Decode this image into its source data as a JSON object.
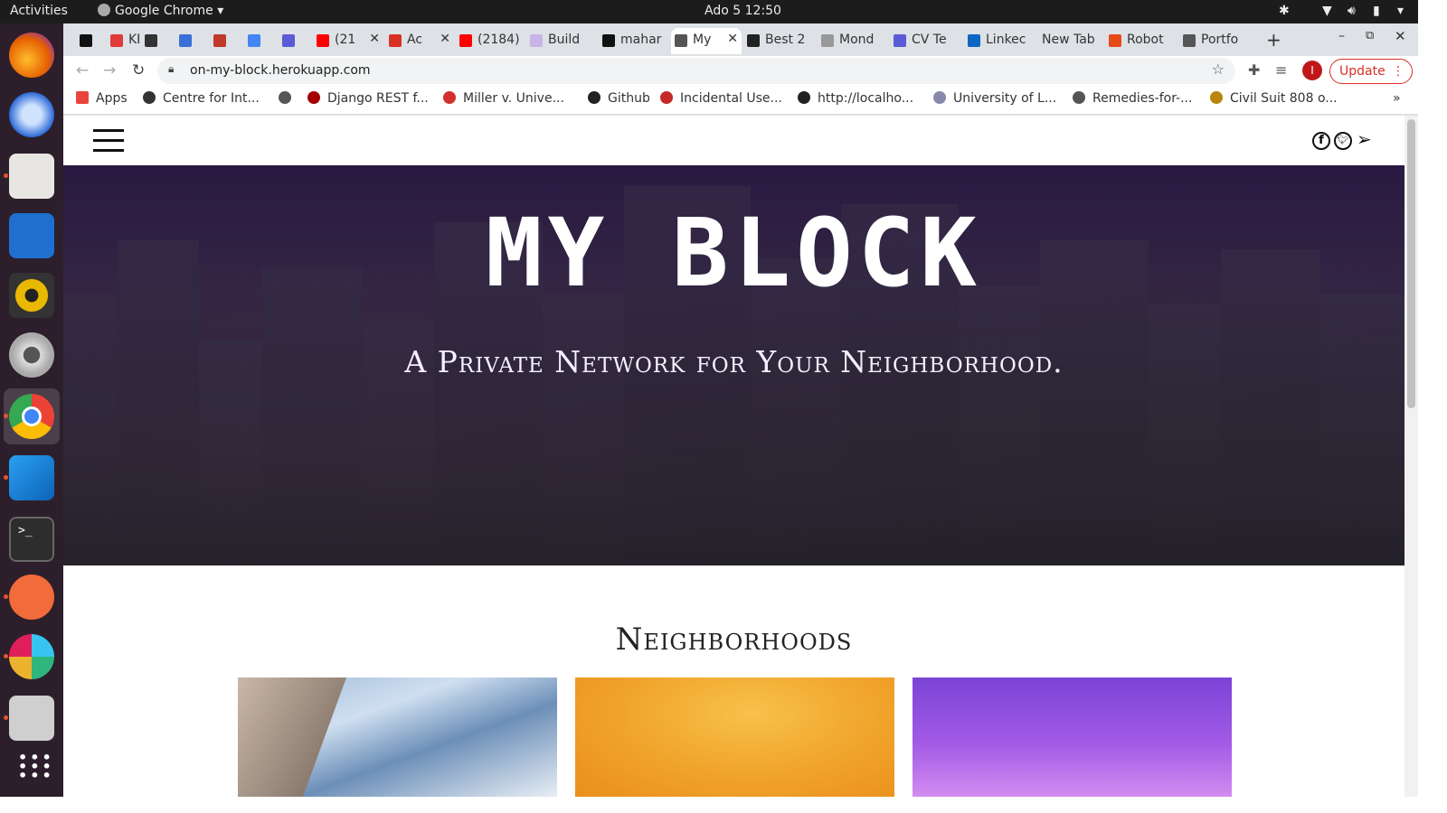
{
  "system": {
    "activities": "Activities",
    "app_name": "Google Chrome",
    "clock": "Ado 5  12:50"
  },
  "tabs": [
    {
      "label": "",
      "color": "#111111"
    },
    {
      "label": "KP",
      "color": "#e03a3a"
    },
    {
      "label": "",
      "color": "#333333"
    },
    {
      "label": "",
      "color": "#3a6fd8"
    },
    {
      "label": "",
      "color": "#c0392b"
    },
    {
      "label": "",
      "color": "#4285f4"
    },
    {
      "label": "",
      "color": "#5b5bd6"
    },
    {
      "label": "(21",
      "color": "#ff0000"
    },
    {
      "label": "Ac",
      "color": "#d93025"
    },
    {
      "label": "(2184)",
      "color": "#ff0000"
    },
    {
      "label": "Build",
      "color": "#c9b4e8"
    },
    {
      "label": "mahar",
      "color": "#111111"
    },
    {
      "label": "My",
      "color": "#555555"
    },
    {
      "label": "Best 2",
      "color": "#222222"
    },
    {
      "label": "Mond",
      "color": "#999999"
    },
    {
      "label": "CV Te",
      "color": "#5b5bd6"
    },
    {
      "label": "Linkec",
      "color": "#0a66c2"
    },
    {
      "label": "New Tab",
      "color": ""
    },
    {
      "label": "Robot",
      "color": "#e64a19"
    },
    {
      "label": "Portfo",
      "color": "#555555"
    }
  ],
  "address": {
    "url": "on-my-block.herokuapp.com"
  },
  "update_button": "Update",
  "profile_initial": "I",
  "bookmarks": [
    {
      "label": "Apps",
      "color": "#e8453c"
    },
    {
      "label": "Centre for Int...",
      "color": "#333333"
    },
    {
      "label": "",
      "color": "#555555"
    },
    {
      "label": "Django REST f...",
      "color": "#a30000"
    },
    {
      "label": "Miller v. Unive...",
      "color": "#d32f2f"
    },
    {
      "label": "Github",
      "color": "#222222"
    },
    {
      "label": "Incidental Use...",
      "color": "#c62828"
    },
    {
      "label": "http://localho...",
      "color": "#222222"
    },
    {
      "label": "University of L...",
      "color": "#8888aa"
    },
    {
      "label": "Remedies-for-...",
      "color": "#555555"
    },
    {
      "label": "Civil Suit 808 o...",
      "color": "#b8860b"
    }
  ],
  "site": {
    "hero_title": "MY BLOCK",
    "hero_subtitle": "A Private Network for Your Neighborhood.",
    "section_title": "Neighborhoods",
    "social": [
      "facebook-icon",
      "twitter-icon",
      "telegram-icon"
    ]
  },
  "colors": {
    "update_button": "#d93025",
    "hero_title": "#ffffff",
    "heading": "#222222"
  }
}
